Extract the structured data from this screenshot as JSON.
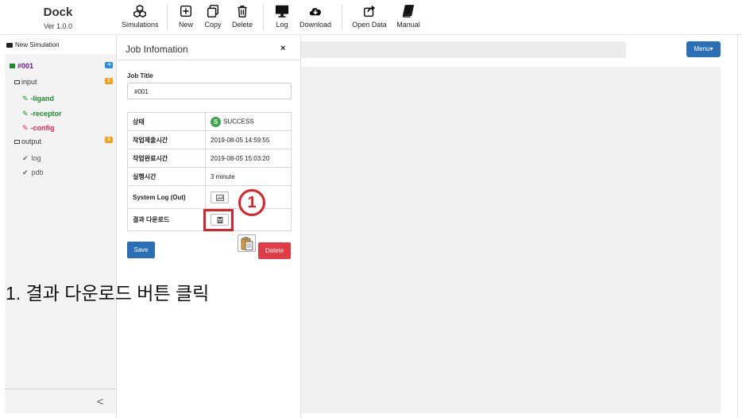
{
  "brand": {
    "name": "Dock",
    "version": "Ver 1.0.0"
  },
  "toolbar": {
    "simulations": "Simulations",
    "new": "New",
    "copy": "Copy",
    "delete": "Delete",
    "log": "Log",
    "download": "Download",
    "open_data": "Open Data",
    "manual": "Manual"
  },
  "sidebar": {
    "new_simulation": "New Simulation",
    "job": "#001",
    "input": "input",
    "input_count": "3",
    "input_items": [
      "-ligand",
      "-receptor",
      "-config"
    ],
    "output": "output",
    "output_count": "2",
    "output_items": [
      "log",
      "pdb"
    ],
    "collapse_glyph": "<"
  },
  "main": {
    "menu_label": "Menu▾"
  },
  "job_panel": {
    "title": "Job Infomation",
    "close": "×",
    "job_title_label": "Job Title",
    "job_title_value": "#001",
    "rows": {
      "status_label": "상태",
      "status_icon_letter": "S",
      "status_value": "SUCCESS",
      "submit_label": "작업제출시간",
      "submit_value": "2019-08-05 14:59:55",
      "done_label": "작업완료시간",
      "done_value": "2019-08-05 15:03:20",
      "run_label": "실행시간",
      "run_value": "3 minute",
      "syslog_label": "System Log (Out)",
      "download_label": "결과 다운로드"
    },
    "save": "Save",
    "delete": "Delete"
  },
  "annotation": {
    "step_number": "1",
    "caption": "1. 결과 다운로드 버튼 클릭",
    "highlight_color": "#d8232a"
  },
  "colors": {
    "primary": "#2a6fb5",
    "danger": "#e13c45",
    "success": "#3aa64a",
    "job_purple": "#6a1b9a",
    "green_item": "#1a8a2a",
    "config_red": "#e0245e",
    "badge_blue": "#2a8ad6",
    "badge_orange": "#f0a020"
  }
}
